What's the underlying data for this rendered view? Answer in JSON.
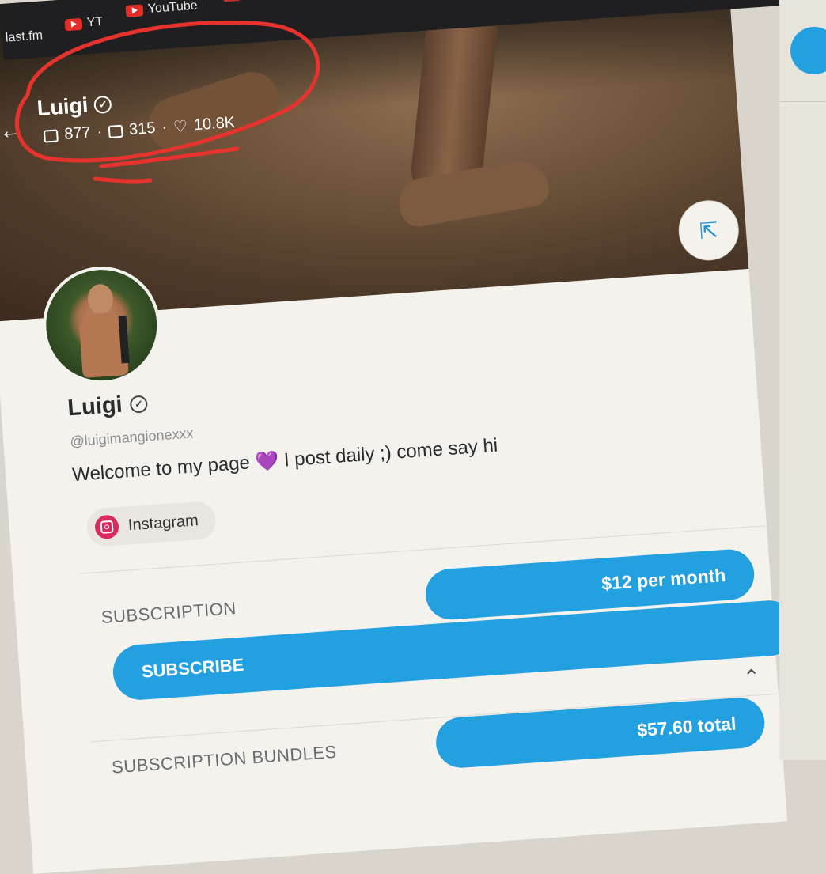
{
  "bookmarks": [
    {
      "label": "last.fm"
    },
    {
      "label": "YT"
    },
    {
      "label": "YouTube"
    }
  ],
  "cover": {
    "name": "Luigi",
    "photos_count": "877",
    "videos_count": "315",
    "likes_count": "10.8K",
    "separator": "·"
  },
  "profile": {
    "name": "Luigi",
    "handle": "@luigimangionexxx",
    "bio_before": "Welcome to my page",
    "bio_emoji": "💜",
    "bio_after": "I post daily ;) come say hi",
    "link_label": "Instagram"
  },
  "subscription": {
    "label": "SUBSCRIPTION",
    "price": "$12 per month",
    "button": "SUBSCRIBE"
  },
  "bundles": {
    "label": "SUBSCRIPTION BUNDLES",
    "price": "$57.60 total"
  },
  "colors": {
    "accent": "#22a0e0",
    "annotation": "#e6332e",
    "instagram": "#d92b5f"
  },
  "icons": [
    "back-arrow-icon",
    "verified-icon",
    "photo-icon",
    "video-icon",
    "heart-icon",
    "share-icon",
    "instagram-icon",
    "chevron-up-icon"
  ]
}
